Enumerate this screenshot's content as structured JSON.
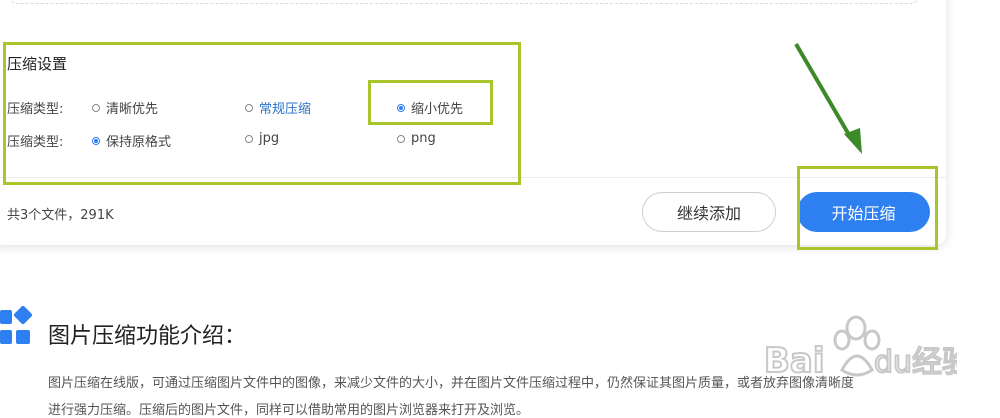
{
  "compression_settings": {
    "title": "压缩设置",
    "rows": [
      {
        "label": "压缩类型:",
        "options": [
          {
            "text": "清晰优先",
            "selected": false
          },
          {
            "text": "常规压缩",
            "selected": false
          },
          {
            "text": "缩小优先",
            "selected": true
          }
        ]
      },
      {
        "label": "压缩类型:",
        "options": [
          {
            "text": "保持原格式",
            "selected": true
          },
          {
            "text": "jpg",
            "selected": false
          },
          {
            "text": "png",
            "selected": false
          }
        ]
      }
    ]
  },
  "footer": {
    "file_count": "共3个文件，291K",
    "continue_button": "继续添加",
    "start_button": "开始压缩"
  },
  "intro": {
    "title": "图片压缩功能介绍：",
    "line1": "图片压缩在线版，可通过压缩图片文件中的图像，来减少文件的大小，并在图片文件压缩过程中，仍然保证其图片质量，或者放弃图像清晰度",
    "line2": "进行强力压缩。压缩后的图片文件，同样可以借助常用的图片浏览器来打开及浏览。"
  },
  "watermark": {
    "brand_text": "Baidu经验"
  },
  "colors": {
    "accent": "#2e7fef",
    "highlight": "#a8c62b",
    "arrow": "#3d8a2a",
    "link": "#2a72c8"
  }
}
